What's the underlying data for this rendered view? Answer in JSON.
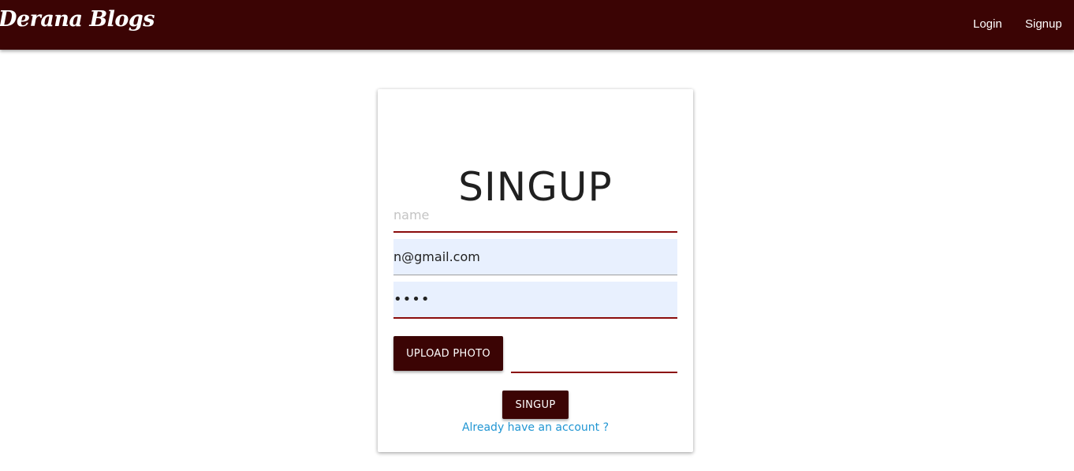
{
  "navbar": {
    "brand": "Derana Blogs",
    "links": [
      {
        "label": "Login"
      },
      {
        "label": "Signup"
      }
    ],
    "background_color": "#3b0404"
  },
  "form": {
    "title": "SINGUP",
    "name": {
      "placeholder": "name",
      "value": ""
    },
    "email": {
      "value": "n@gmail.com"
    },
    "password": {
      "value": "••••"
    },
    "upload_label": "UPLOAD PHOTO",
    "file_path": {
      "value": ""
    },
    "submit_label": "SINGUP",
    "account_link": "Already have an account ?"
  },
  "colors": {
    "accent": "#3b0404",
    "underline": "#8b0c0c",
    "autofill": "#e8f0fe",
    "link": "#2196d3"
  }
}
